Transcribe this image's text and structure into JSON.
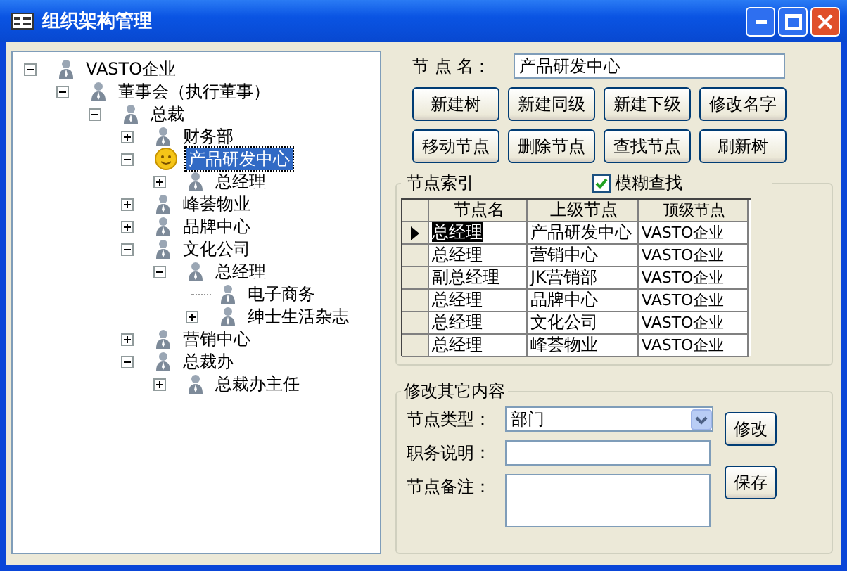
{
  "window": {
    "title": "组织架构管理"
  },
  "tree": [
    {
      "label": "VASTO企业",
      "selected": false,
      "expanded": true,
      "children": [
        {
          "label": "董事会（执行董事）",
          "selected": false,
          "expanded": true,
          "children": [
            {
              "label": "总裁",
              "selected": false,
              "expanded": true,
              "children": [
                {
                  "label": "财务部",
                  "selected": false,
                  "expanded": false
                },
                {
                  "label": "产品研发中心",
                  "selected": true,
                  "expanded": true,
                  "children": [
                    {
                      "label": "总经理",
                      "selected": false,
                      "expanded": false
                    }
                  ]
                },
                {
                  "label": "峰荟物业",
                  "selected": false,
                  "expanded": false
                },
                {
                  "label": "品牌中心",
                  "selected": false,
                  "expanded": false
                },
                {
                  "label": "文化公司",
                  "selected": false,
                  "expanded": true,
                  "children": [
                    {
                      "label": "总经理",
                      "selected": false,
                      "expanded": true,
                      "children": [
                        {
                          "label": "电子商务",
                          "selected": false
                        },
                        {
                          "label": "绅士生活杂志",
                          "selected": false,
                          "expanded": false
                        }
                      ]
                    }
                  ]
                },
                {
                  "label": "营销中心",
                  "selected": false,
                  "expanded": false
                },
                {
                  "label": "总裁办",
                  "selected": false,
                  "expanded": true,
                  "children": [
                    {
                      "label": "总裁办主任",
                      "selected": false,
                      "expanded": false
                    }
                  ]
                }
              ]
            }
          ]
        }
      ]
    }
  ],
  "node_name": {
    "label": "节 点 名：",
    "value": "产品研发中心"
  },
  "buttons": [
    [
      "新建树",
      "新建同级",
      "新建下级",
      "修改名字"
    ],
    [
      "移动节点",
      "删除节点",
      "查找节点",
      "刷新树"
    ]
  ],
  "index_group": {
    "title": "节点索引",
    "fuzzy_search": {
      "label": "模糊查找",
      "checked": true
    },
    "grid": {
      "columns": [
        "节点名",
        "上级节点",
        "顶级节点"
      ],
      "rows": [
        {
          "cells": [
            "总经理",
            "产品研发中心",
            "VASTO企业"
          ],
          "selected": true
        },
        {
          "cells": [
            "总经理",
            "营销中心",
            "VASTO企业"
          ],
          "selected": false
        },
        {
          "cells": [
            "副总经理",
            "JK营销部",
            "VASTO企业"
          ],
          "selected": false
        },
        {
          "cells": [
            "总经理",
            "品牌中心",
            "VASTO企业"
          ],
          "selected": false
        },
        {
          "cells": [
            "总经理",
            "文化公司",
            "VASTO企业"
          ],
          "selected": false
        },
        {
          "cells": [
            "总经理",
            "峰荟物业",
            "VASTO企业"
          ],
          "selected": false
        }
      ]
    }
  },
  "edit_group": {
    "title": "修改其它内容",
    "fields": [
      {
        "kind": "combo",
        "label": "节点类型：",
        "value": "部门"
      },
      {
        "kind": "text",
        "label": "职务说明："
      },
      {
        "kind": "memo",
        "label": "节点备注："
      }
    ],
    "buttons": [
      "修改",
      "保存"
    ]
  }
}
